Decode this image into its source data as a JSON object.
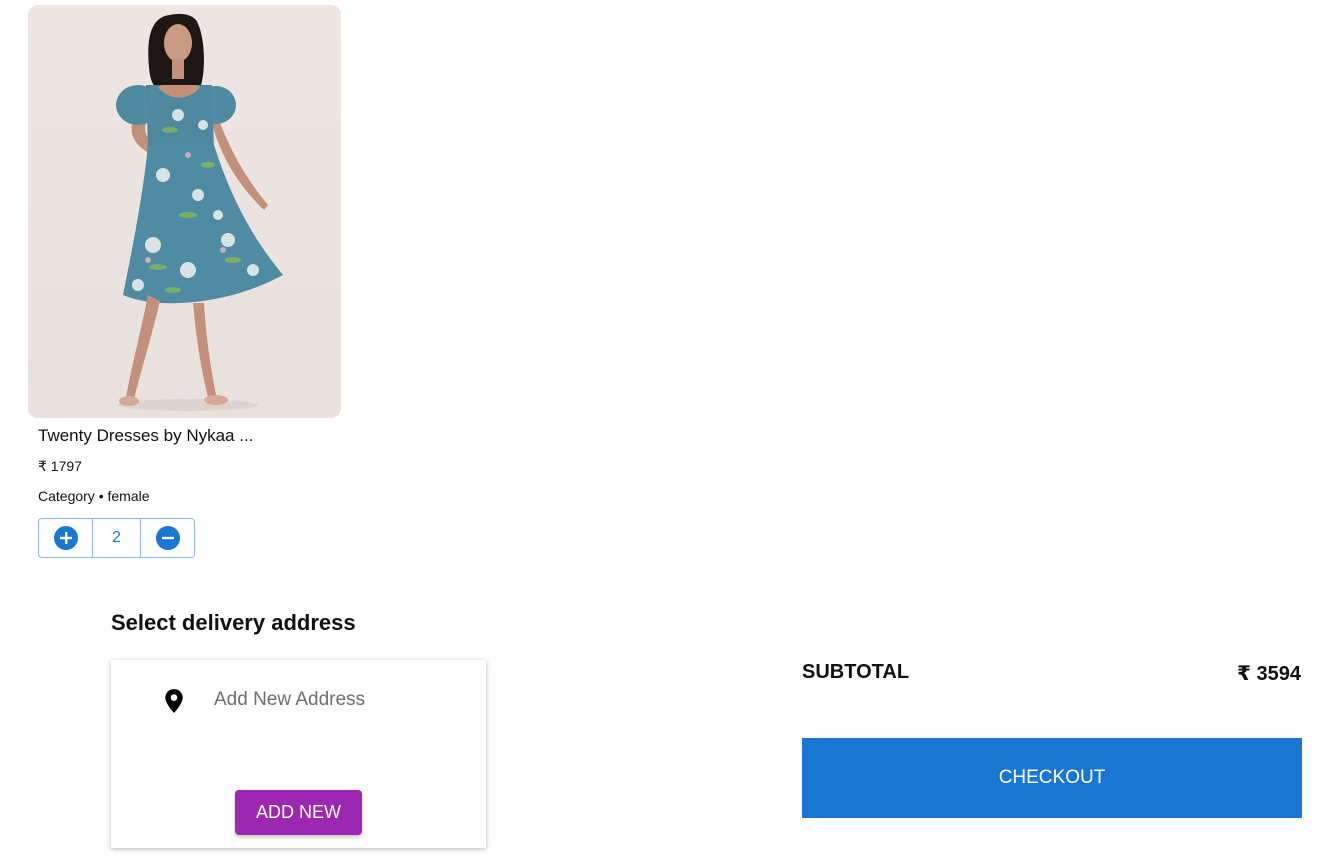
{
  "cart": {
    "product": {
      "title": "Twenty Dresses by Nykaa ...",
      "price": "₹ 1797",
      "category": "Category • female",
      "quantity": "2",
      "image_icon": "dress-model-photo"
    }
  },
  "address": {
    "heading": "Select delivery address",
    "add_label": "Add New Address",
    "add_button": "ADD NEW"
  },
  "summary": {
    "subtotal_label": "SUBTOTAL",
    "subtotal_value": "₹ 3594",
    "checkout_label": "CHECKOUT"
  },
  "colors": {
    "primary": "#1976d2",
    "secondary": "#9c27b0"
  }
}
